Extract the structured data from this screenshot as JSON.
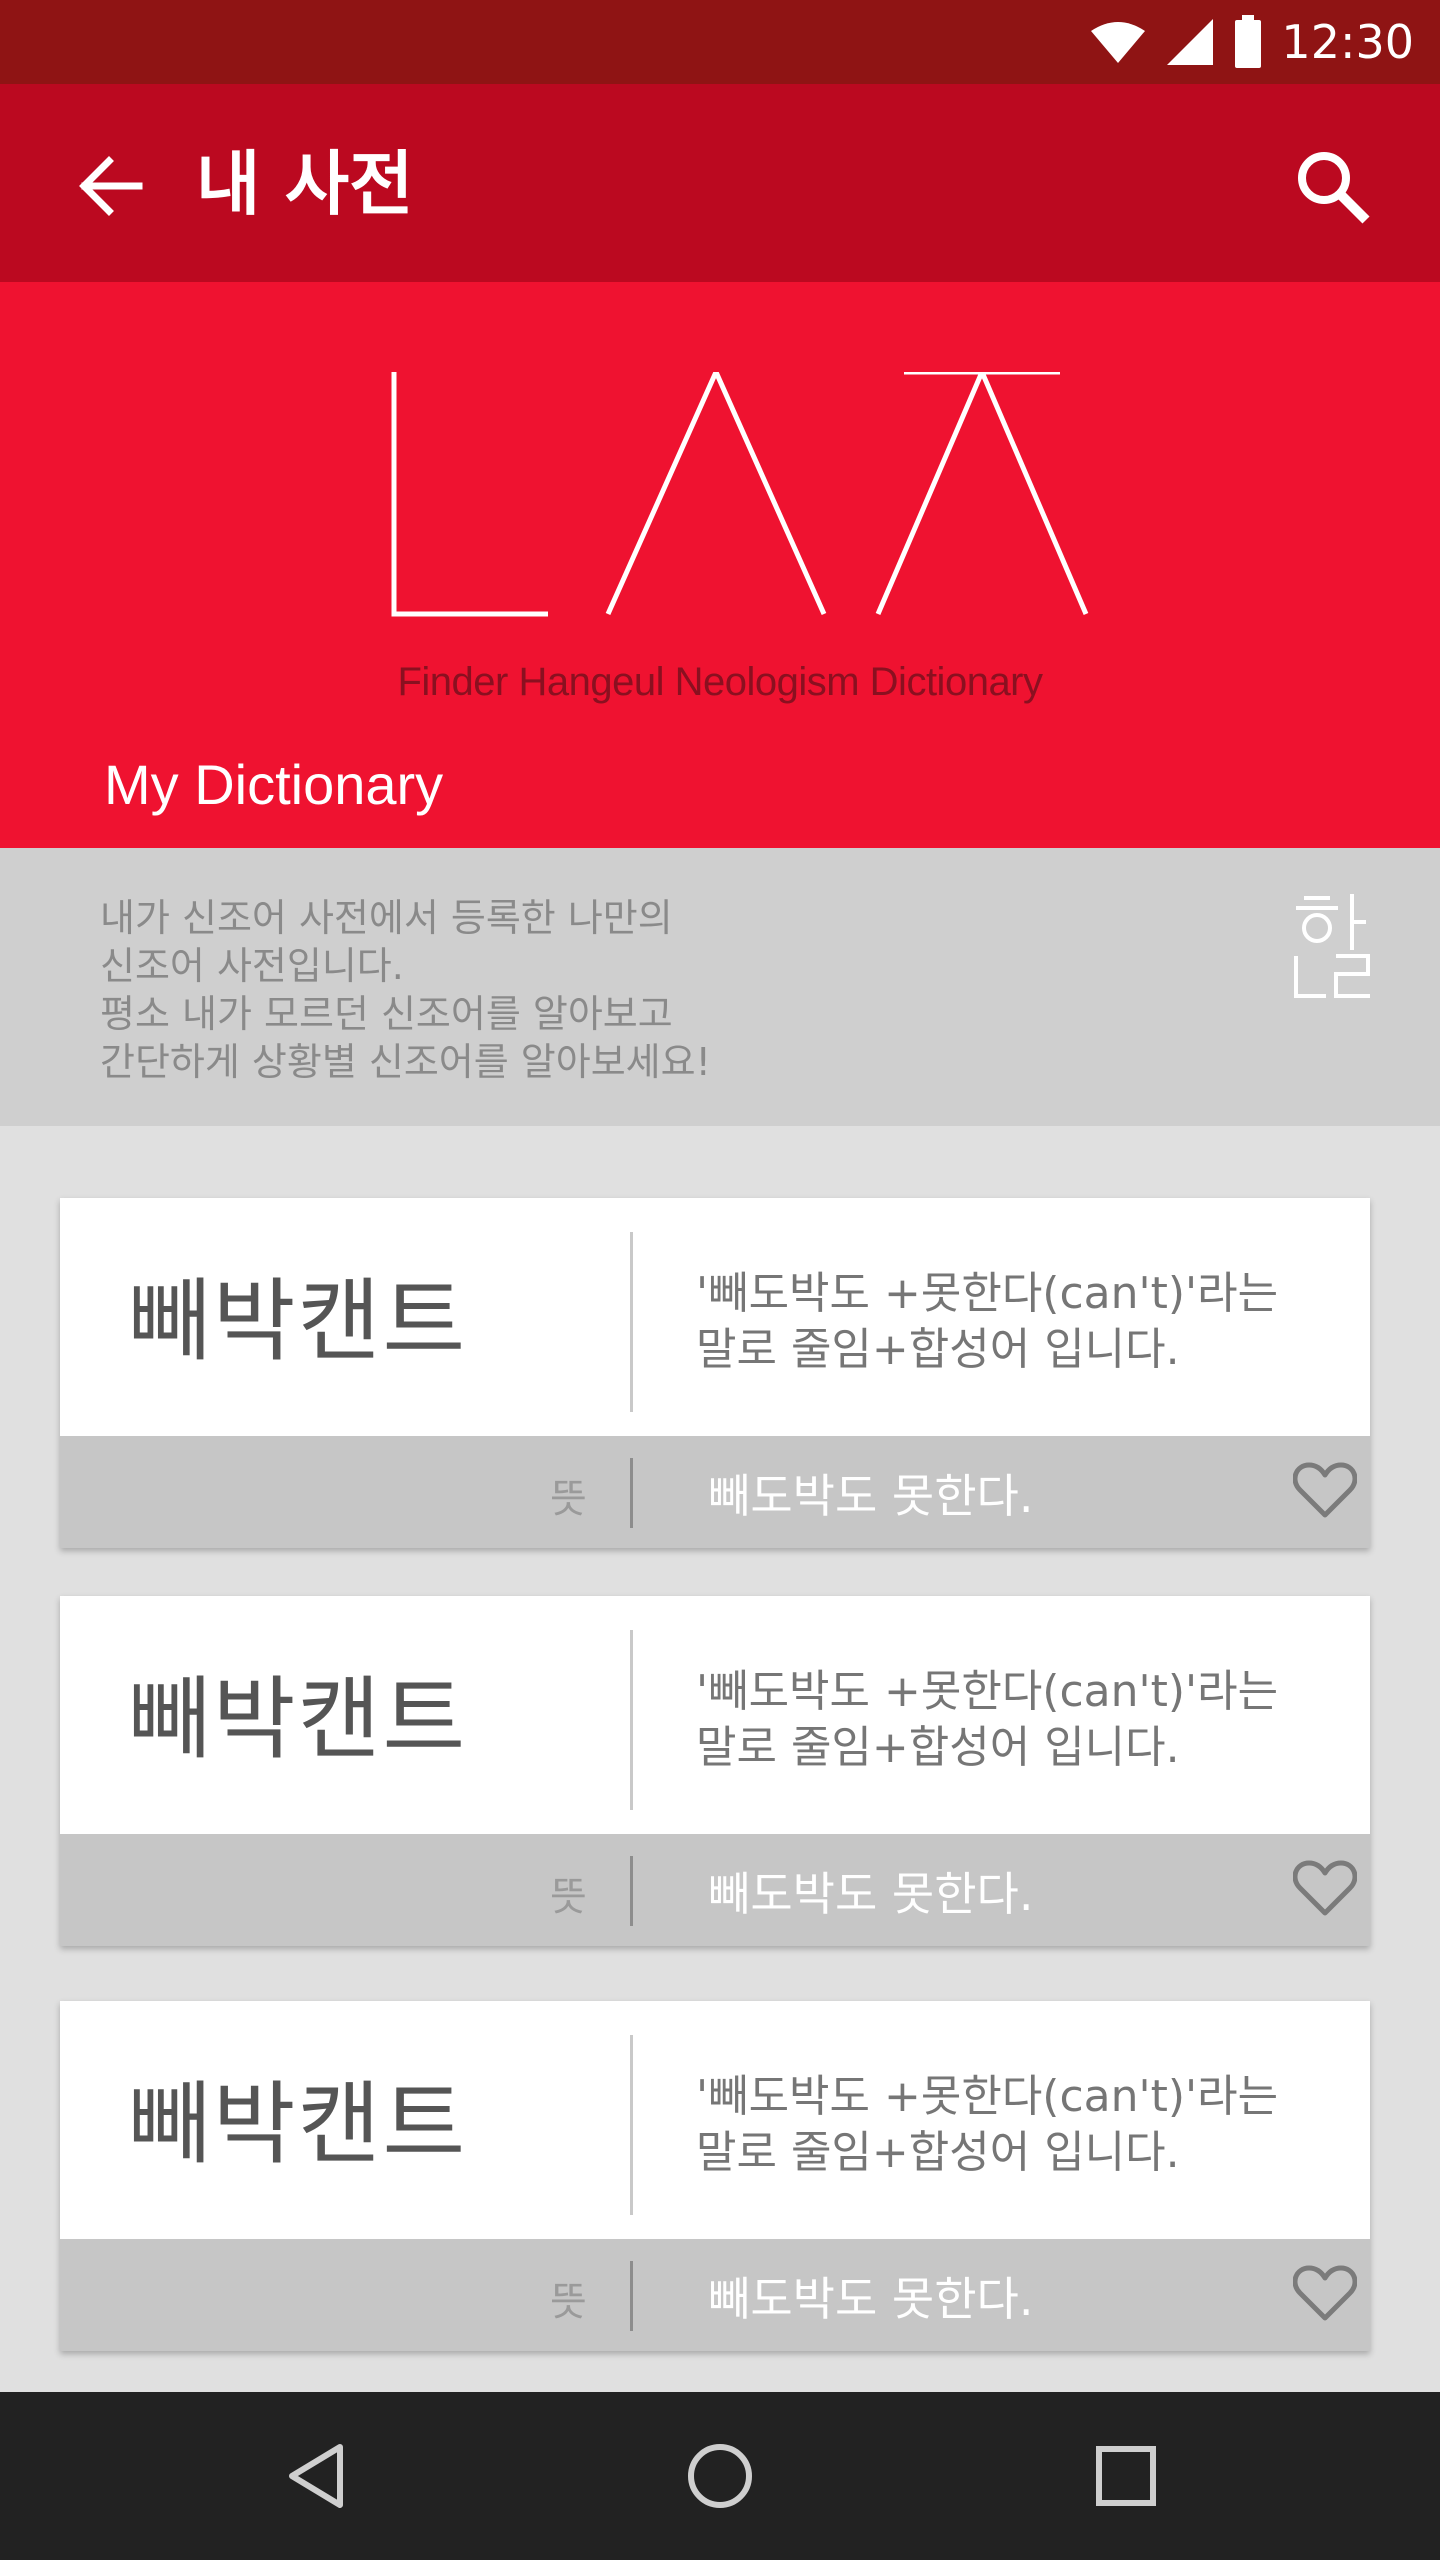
{
  "status_bar": {
    "time": "12:30"
  },
  "app_bar": {
    "title": "내 사전"
  },
  "hero": {
    "logo_text": "ㄴㅅㅈ",
    "tagline": "Finder Hangeul Neologism Dictionary",
    "section_title": "My Dictionary"
  },
  "description": {
    "lines": [
      "내가 신조어 사전에서 등록한 나만의",
      "신조어 사전입니다.",
      "평소 내가 모르던 신조어를 알아보고",
      "간단하게 상황별 신조어를 알아보세요!"
    ],
    "mark_text": "한글"
  },
  "cards": [
    {
      "word": "빼박캔트",
      "explain_line1": "'빼도박도 +못한다(can't)'라는",
      "explain_line2": "말로 줄임+합성어 입니다.",
      "meaning_label": "뜻",
      "meaning": "빼도박도 못한다."
    },
    {
      "word": "빼박캔트",
      "explain_line1": "'빼도박도 +못한다(can't)'라는",
      "explain_line2": "말로 줄임+합성어 입니다.",
      "meaning_label": "뜻",
      "meaning": "빼도박도 못한다."
    },
    {
      "word": "빼박캔트",
      "explain_line1": "'빼도박도 +못한다(can't)'라는",
      "explain_line2": "말로 줄임+합성어 입니다.",
      "meaning_label": "뜻",
      "meaning": "빼도박도 못한다."
    }
  ],
  "colors": {
    "status_bar": "#8f1414",
    "app_bar": "#bb0920",
    "hero": "#ef1230",
    "description_bg": "#cfcfcf",
    "card_footer": "#c6c6c6",
    "nav_bar": "#222222"
  },
  "icons": {
    "back": "arrow-left-icon",
    "search": "search-icon",
    "favorite": "heart-outline-icon",
    "nav_back": "triangle-back-icon",
    "nav_home": "circle-home-icon",
    "nav_recents": "square-recents-icon"
  }
}
